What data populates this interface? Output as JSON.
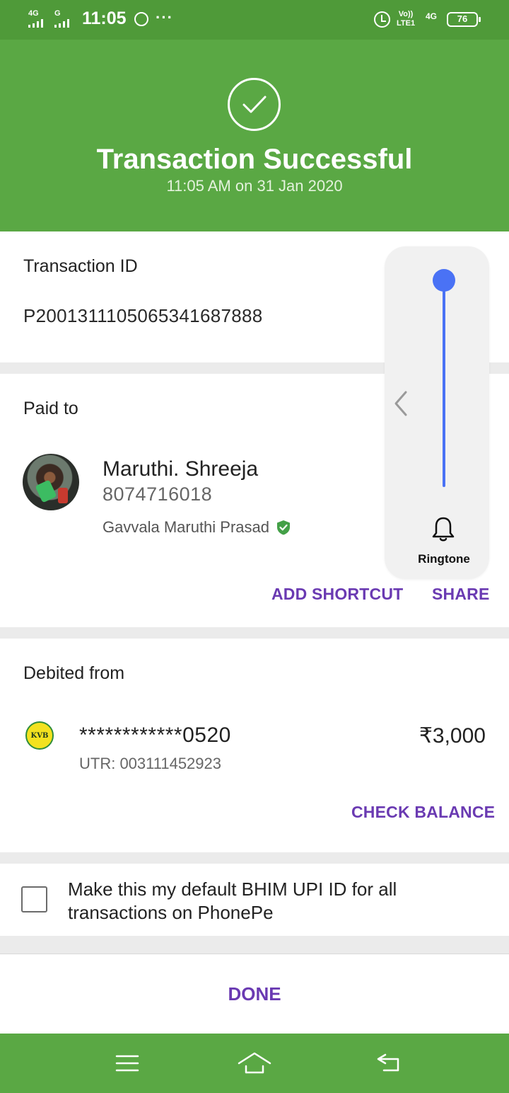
{
  "status_bar": {
    "sim1": "4G",
    "sim2": "G",
    "time": "11:05",
    "more": "···",
    "volte_top": "Vo))",
    "volte_bottom": "LTE1",
    "network": "4G",
    "battery": "76"
  },
  "header": {
    "title": "Transaction Successful",
    "subtitle": "11:05 AM on 31 Jan 2020"
  },
  "transaction": {
    "label": "Transaction ID",
    "id": "P2001311105065341687888"
  },
  "paid_to": {
    "label": "Paid to",
    "name": "Maruthi. Shreeja",
    "phone": "8074716018",
    "legal_name": "Gavvala Maruthi Prasad",
    "add_shortcut": "ADD SHORTCUT",
    "share": "SHARE"
  },
  "debited_from": {
    "label": "Debited from",
    "bank_logo_text": "KVB",
    "account": "************0520",
    "utr": "UTR: 003111452923",
    "amount": "₹3,000",
    "check_balance": "CHECK BALANCE"
  },
  "default_upi": {
    "checked": false,
    "text": "Make this my default BHIM UPI ID for all transactions on PhonePe"
  },
  "done": {
    "label": "DONE"
  },
  "volume": {
    "label": "Ringtone",
    "level": 1.0,
    "accent_color": "#4a72f5"
  },
  "nav": {
    "items": [
      "menu-icon",
      "home-icon",
      "back-icon"
    ]
  },
  "colors": {
    "header_green": "#5aa844",
    "status_green": "#4f9a39",
    "accent_purple": "#6a3ab2"
  }
}
